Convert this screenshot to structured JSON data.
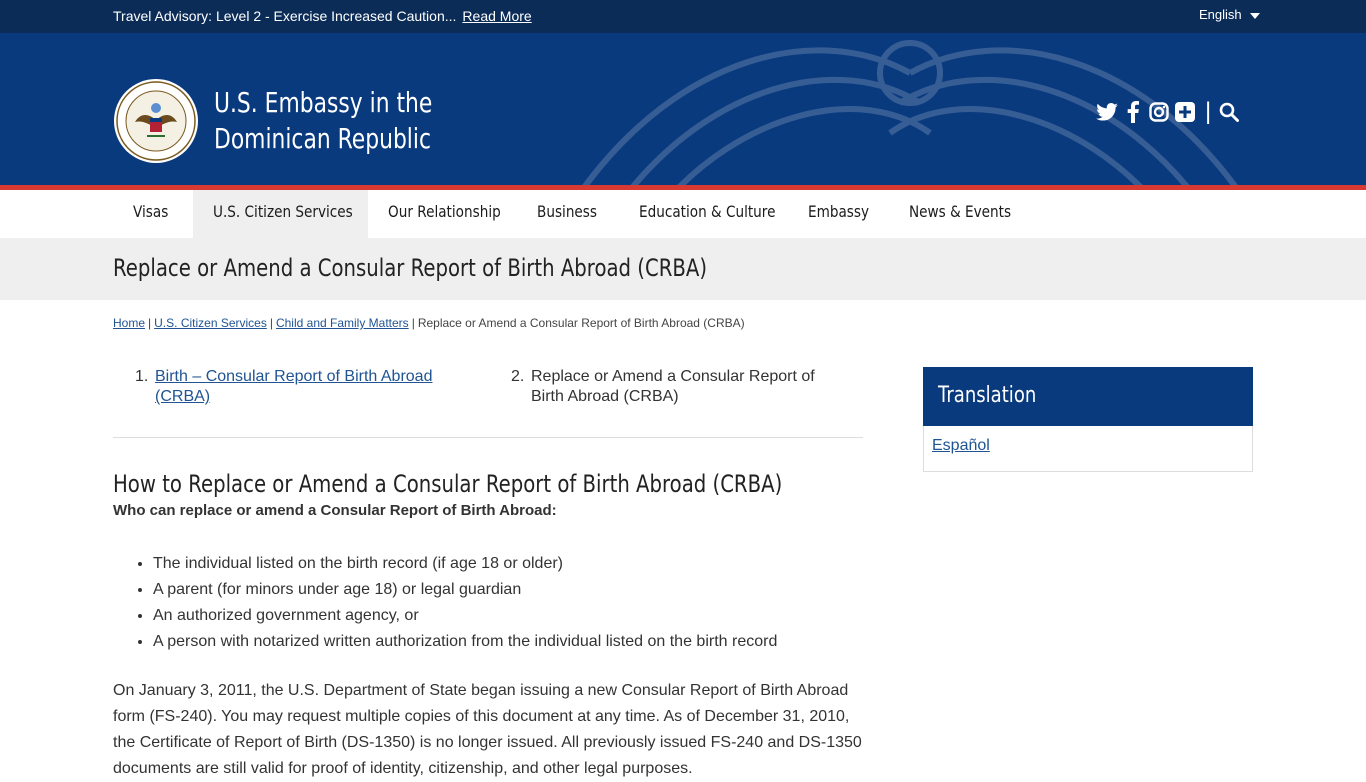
{
  "topbar": {
    "advisory_text": "Travel Advisory: Level 2 - Exercise Increased Caution...",
    "advisory_link": "Read More",
    "language": "English"
  },
  "header": {
    "title_line1": "U.S. Embassy in the",
    "title_line2": "Dominican Republic",
    "social_icons": [
      "twitter-icon",
      "facebook-icon",
      "instagram-icon",
      "flickr-plus-icon",
      "search-icon"
    ]
  },
  "nav": {
    "items": [
      {
        "label": "Visas"
      },
      {
        "label": "U.S. Citizen Services"
      },
      {
        "label": "Our Relationship"
      },
      {
        "label": "Business"
      },
      {
        "label": "Education & Culture"
      },
      {
        "label": "Embassy"
      },
      {
        "label": "News & Events"
      }
    ],
    "active_index": 1
  },
  "page": {
    "title": "Replace or Amend a Consular Report of Birth Abroad (CRBA)"
  },
  "breadcrumb": {
    "items": [
      "Home",
      "U.S. Citizen Services",
      "Child and Family Matters"
    ],
    "current": "Replace or Amend a Consular Report of Birth Abroad (CRBA)"
  },
  "pager": {
    "items": [
      {
        "num": "1.",
        "label": "Birth – Consular Report of Birth Abroad (CRBA)"
      },
      {
        "num": "2.",
        "label": "Replace or Amend a Consular Report of Birth Abroad (CRBA)"
      }
    ]
  },
  "content": {
    "heading": "How to Replace or Amend a Consular Report of Birth Abroad (CRBA)",
    "who_label": "Who can replace or amend a Consular Report of Birth Abroad:",
    "bullets": [
      "The individual listed on the birth record (if age 18 or older)",
      "A parent (for minors under age 18) or legal guardian",
      "An authorized government agency, or",
      "A person with notarized written authorization from the individual listed on the birth record"
    ],
    "paragraph": "On January 3, 2011, the U.S. Department of State began issuing a new Consular Report of Birth Abroad form (FS-240). You may request multiple copies of this document at any time. As of December 31, 2010, the Certificate of Report of Birth (DS-1350) is no longer issued. All previously issued FS-240 and DS-1350 documents are still valid for proof of identity, citizenship, and other legal purposes."
  },
  "sidebar": {
    "title": "Translation",
    "link": "Español"
  }
}
